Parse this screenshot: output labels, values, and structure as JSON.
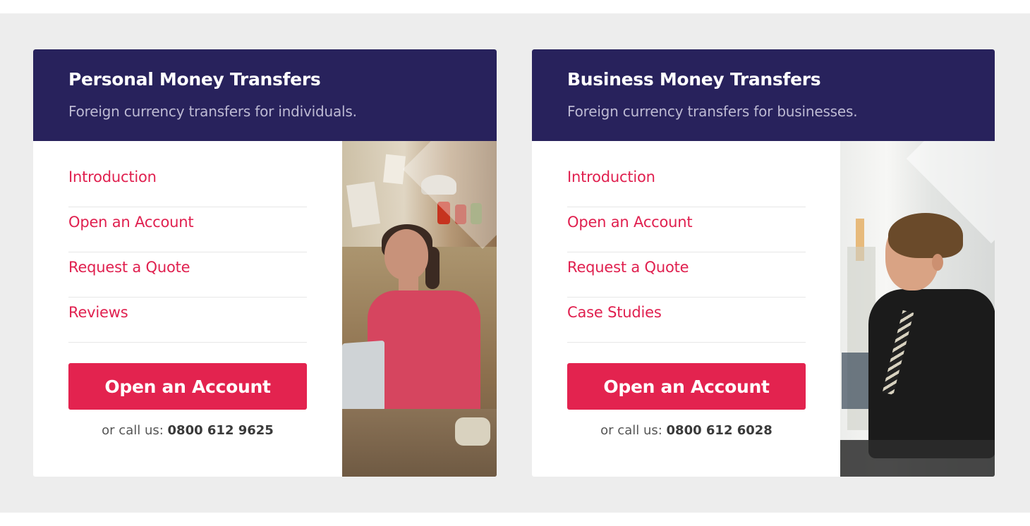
{
  "cards": {
    "personal": {
      "title": "Personal Money Transfers",
      "subtitle": "Foreign currency transfers for individuals.",
      "nav": [
        "Introduction",
        "Open an Account",
        "Request a Quote",
        "Reviews"
      ],
      "cta_label": "Open an Account",
      "call_prefix": "or call us:",
      "phone": "0800 612 9625"
    },
    "business": {
      "title": "Business Money Transfers",
      "subtitle": "Foreign currency transfers for businesses.",
      "nav": [
        "Introduction",
        "Open an Account",
        "Request a Quote",
        "Case Studies"
      ],
      "cta_label": "Open an Account",
      "call_prefix": "or call us:",
      "phone": "0800 612 6028"
    }
  },
  "colors": {
    "header_bg": "#28225c",
    "accent": "#e3234f",
    "page_band": "#ededed"
  }
}
